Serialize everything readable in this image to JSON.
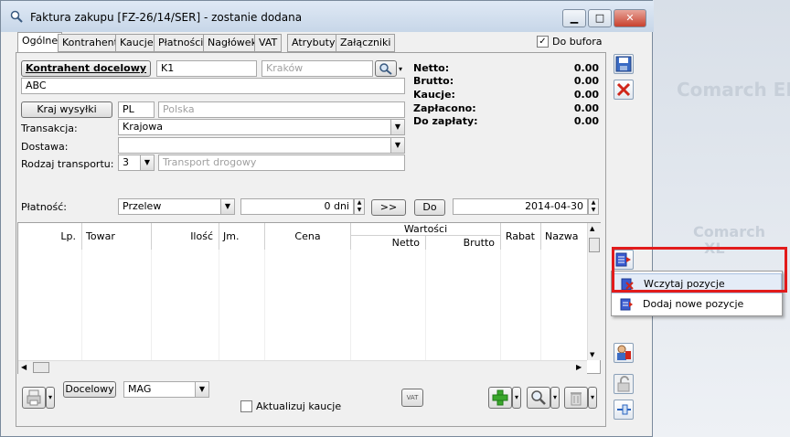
{
  "window": {
    "title": "Faktura zakupu [FZ-26/14/SER]  - zostanie dodana",
    "minimize": "▁",
    "maximize": "□",
    "close": "✕"
  },
  "background": {
    "brand1": "Comarch ERP",
    "brand2": "Comarch",
    "brand3": "XL"
  },
  "tabs": [
    "Ogólne",
    "Kontrahent",
    "Kaucje",
    "Płatności",
    "Nagłówek",
    "VAT",
    "Atrybuty",
    "Załączniki"
  ],
  "do_bufora": {
    "label": "Do bufora",
    "checked": true
  },
  "contractor": {
    "button": "Kontrahent docelowy",
    "code": "K1",
    "city_placeholder": "Kraków",
    "name": "ABC"
  },
  "country": {
    "button": "Kraj wysyłki",
    "code": "PL",
    "name": "Polska"
  },
  "form": {
    "transakcja_label": "Transakcja:",
    "transakcja_value": "Krajowa",
    "dostawa_label": "Dostawa:",
    "dostawa_value": "",
    "rodzaj_label": "Rodzaj transportu:",
    "rodzaj_value": "3",
    "rodzaj_name": "Transport drogowy",
    "platnosc_label": "Płatność:",
    "platnosc_value": "Przelew",
    "days": "0 dni",
    "next_button": ">>",
    "do_button": "Do",
    "date": "2014-04-30"
  },
  "summary": [
    {
      "label": "Netto:",
      "value": "0.00"
    },
    {
      "label": "Brutto:",
      "value": "0.00"
    },
    {
      "label": "Kaucje:",
      "value": "0.00"
    },
    {
      "label": "Zapłacono:",
      "value": "0.00"
    },
    {
      "label": "Do zapłaty:",
      "value": "0.00"
    }
  ],
  "table": {
    "columns": [
      "Lp.",
      "Towar",
      "Ilość",
      "Jm.",
      "Cena",
      "Netto",
      "Brutto",
      "Rabat",
      "Nazwa"
    ],
    "group_header": "Wartości",
    "rows": []
  },
  "bottom": {
    "docelowy_button": "Docelowy",
    "warehouse": "MAG",
    "aktualizuj_label": "Aktualizuj kaucje",
    "aktualizuj_checked": false,
    "vat_button": "VAT"
  },
  "popup_menu": [
    {
      "label": "Wczytaj pozycje"
    },
    {
      "label": "Dodaj nowe pozycje"
    }
  ],
  "colors": {
    "highlight_box": "#e21b1b",
    "accent": "#2a64c0"
  }
}
